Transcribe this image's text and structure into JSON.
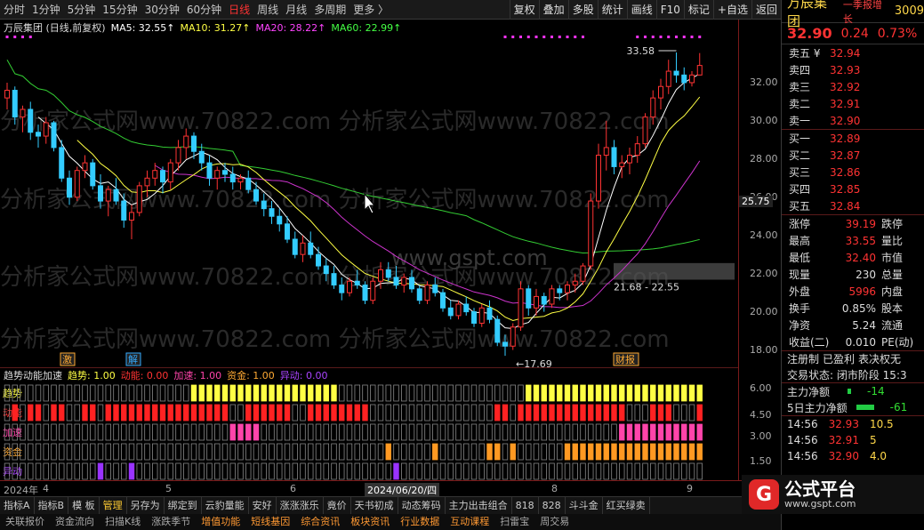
{
  "toolbar": {
    "periods": [
      "分时",
      "1分钟",
      "5分钟",
      "15分钟",
      "30分钟",
      "60分钟",
      "日线",
      "周线",
      "月线",
      "多周期",
      "更多 〉"
    ],
    "active_period": "日线",
    "tools": [
      "复权",
      "叠加",
      "多股",
      "统计",
      "画线",
      "F10",
      "标记",
      "+自选",
      "返回"
    ]
  },
  "chart_header": {
    "stock": "万辰集团 (日线,前复权)",
    "ma5": "MA5: 32.55↑",
    "ma10": "MA10: 31.27↑",
    "ma20": "MA20: 28.22↑",
    "ma60": "MA60: 22.99↑"
  },
  "indicator_header": {
    "name": "趋势动能加速",
    "trend": "趋势: 1.00",
    "momentum": "动能: 0.00",
    "accel": "加速: 1.00",
    "capital": "资金: 1.00",
    "anomaly": "异动: 0.00"
  },
  "indicator_rows": [
    "趋势",
    "动能",
    "加速",
    "资金",
    "异动"
  ],
  "price_axis": [
    "32.00",
    "30.00",
    "28.00",
    "26.00",
    "24.00",
    "22.00",
    "20.00",
    "18.00"
  ],
  "indicator_axis": [
    "6.00",
    "4.50",
    "3.00",
    "1.50"
  ],
  "annotations": {
    "high": "33.58",
    "low": "17.69",
    "range": "21.68 - 22.55",
    "current_mark": "25.75",
    "event1": "激",
    "event2": "解",
    "event3": "财报"
  },
  "date_axis": [
    "2024年",
    "4",
    "5",
    "6",
    "2024/06/20/四",
    "8",
    "9"
  ],
  "watermarks": [
    "分析家公式网www.70822.com",
    "www.gspt.com"
  ],
  "bottom_tabs": [
    "指标A",
    "指标B",
    "模 板",
    "管理",
    "另存为",
    "绑定到",
    "云豹量能",
    "安好",
    "涨涨涨乐",
    "竟价",
    "天书初成",
    "动态筹码",
    "主力出击组合",
    "818",
    "828",
    "斗斗金",
    "红买绿卖"
  ],
  "active_tab": "管理",
  "bottom_tabs2": [
    "关联报价",
    "资金流向",
    "扫描K线",
    "涨跌季节",
    "增值功能",
    "短线基因",
    "综合资讯",
    "板块资讯",
    "行业数据",
    "互动课程",
    "扫雷宝",
    "周交易"
  ],
  "side": {
    "name": "万辰集团",
    "tag": "一季报增长",
    "code": "3009",
    "price": "32.90",
    "change": "0.24",
    "pct": "0.73%",
    "asks": [
      {
        "label": "卖五 ¥",
        "price": "32.94"
      },
      {
        "label": "卖四",
        "price": "32.93"
      },
      {
        "label": "卖三",
        "price": "32.92"
      },
      {
        "label": "卖二",
        "price": "32.91"
      },
      {
        "label": "卖一",
        "price": "32.90"
      }
    ],
    "bids": [
      {
        "label": "买一",
        "price": "32.89"
      },
      {
        "label": "买二",
        "price": "32.87"
      },
      {
        "label": "买三",
        "price": "32.86"
      },
      {
        "label": "买四",
        "price": "32.85"
      },
      {
        "label": "买五",
        "price": "32.84"
      }
    ],
    "quotes": [
      {
        "l1": "涨停",
        "v1": "39.19",
        "c": "red",
        "l2": "跌停"
      },
      {
        "l1": "最高",
        "v1": "33.55",
        "c": "red",
        "l2": "量比"
      },
      {
        "l1": "最低",
        "v1": "32.40",
        "c": "red",
        "l2": "市值"
      },
      {
        "l1": "现量",
        "v1": "230",
        "c": "",
        "l2": "总量"
      },
      {
        "l1": "外盘",
        "v1": "5996",
        "c": "red",
        "l2": "内盘"
      },
      {
        "l1": "换手",
        "v1": "0.85%",
        "c": "",
        "l2": "股本"
      },
      {
        "l1": "净资",
        "v1": "5.24",
        "c": "",
        "l2": "流通"
      },
      {
        "l1": "收益(二)",
        "v1": "0.010",
        "c": "",
        "l2": "PE(动)"
      }
    ],
    "info": [
      "注册制",
      "已盈利",
      "表决权无"
    ],
    "status": "交易状态: 闭市阶段 15:3",
    "flows": [
      {
        "label": "主力净额",
        "value": "-14"
      },
      {
        "label": "5日主力净额",
        "value": "-61"
      }
    ],
    "ticks": [
      {
        "t": "14:56",
        "p": "32.93",
        "v": "10.5"
      },
      {
        "t": "14:56",
        "p": "32.91",
        "v": "5"
      },
      {
        "t": "14:56",
        "p": "32.90",
        "v": "4.0"
      }
    ]
  },
  "brand": {
    "title": "公式平台",
    "url": "www.gspt.com"
  },
  "chart_data": {
    "type": "candlestick",
    "title": "万辰集团 (日线,前复权)",
    "ylim": [
      17.0,
      34.0
    ],
    "candles": [
      [
        31.2,
        32.0,
        30.6,
        31.6
      ],
      [
        31.6,
        31.8,
        29.8,
        30.2
      ],
      [
        30.2,
        30.8,
        29.4,
        30.6
      ],
      [
        30.6,
        31.0,
        29.0,
        29.4
      ],
      [
        29.4,
        29.8,
        28.6,
        29.2
      ],
      [
        29.2,
        30.2,
        28.8,
        29.9
      ],
      [
        29.9,
        30.0,
        28.4,
        28.6
      ],
      [
        28.6,
        29.0,
        26.8,
        27.0
      ],
      [
        27.0,
        27.4,
        25.6,
        26.0
      ],
      [
        26.0,
        27.6,
        25.8,
        27.4
      ],
      [
        27.4,
        28.2,
        27.0,
        27.8
      ],
      [
        27.8,
        28.0,
        26.4,
        26.6
      ],
      [
        26.6,
        27.2,
        25.4,
        25.8
      ],
      [
        25.8,
        26.6,
        25.0,
        26.4
      ],
      [
        26.4,
        27.0,
        25.6,
        25.8
      ],
      [
        25.8,
        26.2,
        24.4,
        24.8
      ],
      [
        24.8,
        25.6,
        23.8,
        25.2
      ],
      [
        25.2,
        26.8,
        25.0,
        26.6
      ],
      [
        26.6,
        27.4,
        26.0,
        27.0
      ],
      [
        27.0,
        27.8,
        26.6,
        27.4
      ],
      [
        27.4,
        27.6,
        26.2,
        26.8
      ],
      [
        26.8,
        28.0,
        26.4,
        27.8
      ],
      [
        27.8,
        29.0,
        27.4,
        28.6
      ],
      [
        28.6,
        29.6,
        28.0,
        29.2
      ],
      [
        29.2,
        29.4,
        28.0,
        28.4
      ],
      [
        28.4,
        28.8,
        27.4,
        27.8
      ],
      [
        27.8,
        28.2,
        26.6,
        27.0
      ],
      [
        27.0,
        27.6,
        26.4,
        27.4
      ],
      [
        27.4,
        27.8,
        26.8,
        27.2
      ],
      [
        27.2,
        27.6,
        26.4,
        26.8
      ],
      [
        26.8,
        27.2,
        26.4,
        27.0
      ],
      [
        27.0,
        27.4,
        26.2,
        26.4
      ],
      [
        26.4,
        26.8,
        25.6,
        25.8
      ],
      [
        25.8,
        26.2,
        25.0,
        25.4
      ],
      [
        25.4,
        25.8,
        24.6,
        25.0
      ],
      [
        25.0,
        25.4,
        24.2,
        24.6
      ],
      [
        24.6,
        25.0,
        23.6,
        23.8
      ],
      [
        23.8,
        24.2,
        22.8,
        23.0
      ],
      [
        23.0,
        24.0,
        22.6,
        23.6
      ],
      [
        23.6,
        24.2,
        22.8,
        23.0
      ],
      [
        23.0,
        23.4,
        22.2,
        22.4
      ],
      [
        22.4,
        22.8,
        21.6,
        22.0
      ],
      [
        22.0,
        22.4,
        21.2,
        21.4
      ],
      [
        21.4,
        21.8,
        20.6,
        21.0
      ],
      [
        21.0,
        21.8,
        20.8,
        21.6
      ],
      [
        21.6,
        22.2,
        21.2,
        21.4
      ],
      [
        21.4,
        21.6,
        20.4,
        20.6
      ],
      [
        20.6,
        21.8,
        20.4,
        21.6
      ],
      [
        21.6,
        22.6,
        21.2,
        22.2
      ],
      [
        22.2,
        22.6,
        21.6,
        21.8
      ],
      [
        21.8,
        22.4,
        21.2,
        21.4
      ],
      [
        21.4,
        22.0,
        21.0,
        21.8
      ],
      [
        21.8,
        22.2,
        21.0,
        21.2
      ],
      [
        21.2,
        21.4,
        20.4,
        20.6
      ],
      [
        20.6,
        21.6,
        20.4,
        21.4
      ],
      [
        21.4,
        21.8,
        20.8,
        21.0
      ],
      [
        21.0,
        21.2,
        20.0,
        20.2
      ],
      [
        20.2,
        20.6,
        19.6,
        19.8
      ],
      [
        19.8,
        20.6,
        19.6,
        20.4
      ],
      [
        20.4,
        20.8,
        19.8,
        20.0
      ],
      [
        20.0,
        20.2,
        19.2,
        19.4
      ],
      [
        19.4,
        20.4,
        19.2,
        20.2
      ],
      [
        20.2,
        20.6,
        19.4,
        19.6
      ],
      [
        19.6,
        19.8,
        18.2,
        18.4
      ],
      [
        18.4,
        18.8,
        17.69,
        18.2
      ],
      [
        18.2,
        19.4,
        18.0,
        19.2
      ],
      [
        19.2,
        21.6,
        19.0,
        21.2
      ],
      [
        21.2,
        21.4,
        19.8,
        20.2
      ],
      [
        20.2,
        21.2,
        19.8,
        20.8
      ],
      [
        20.8,
        21.0,
        20.0,
        20.4
      ],
      [
        20.4,
        21.4,
        20.2,
        21.2
      ],
      [
        21.2,
        21.4,
        20.6,
        21.0
      ],
      [
        21.0,
        21.6,
        20.6,
        21.4
      ],
      [
        21.4,
        22.0,
        21.0,
        21.6
      ],
      [
        21.6,
        22.55,
        21.4,
        22.4
      ],
      [
        22.4,
        26.2,
        22.2,
        25.8
      ],
      [
        25.8,
        28.8,
        25.4,
        28.2
      ],
      [
        28.2,
        30.0,
        27.4,
        28.6
      ],
      [
        28.6,
        29.0,
        27.2,
        27.6
      ],
      [
        27.6,
        28.2,
        27.0,
        27.8
      ],
      [
        27.8,
        28.6,
        27.2,
        28.2
      ],
      [
        28.2,
        29.2,
        27.8,
        28.8
      ],
      [
        28.8,
        30.4,
        28.6,
        30.2
      ],
      [
        30.2,
        31.6,
        29.8,
        31.2
      ],
      [
        31.2,
        32.2,
        30.6,
        31.8
      ],
      [
        31.8,
        33.2,
        31.4,
        32.6
      ],
      [
        32.6,
        33.58,
        32.0,
        32.4
      ],
      [
        32.4,
        32.8,
        31.6,
        32.0
      ],
      [
        32.0,
        32.6,
        31.8,
        32.4
      ],
      [
        32.4,
        33.55,
        32.4,
        32.9
      ]
    ],
    "indicator_signals": {
      "trend": "0000000000000000000000001111111111111111111000000000000000000000000111111111111111111111111",
      "momentum": "0101101100110111111111111111100111111001111111100000000000000001101111111111111100011100011",
      "accel": "0000000000000000000000000000011110000000000000000000000000000000000000000000000111111111111",
      "capital": "0000000000000000000000000000000000000000000000000100000100000011010000001111111111111111111",
      "anomaly": "0000000000001000100000000000000000000000000000000010000000000000000000000000000000000000000"
    }
  }
}
